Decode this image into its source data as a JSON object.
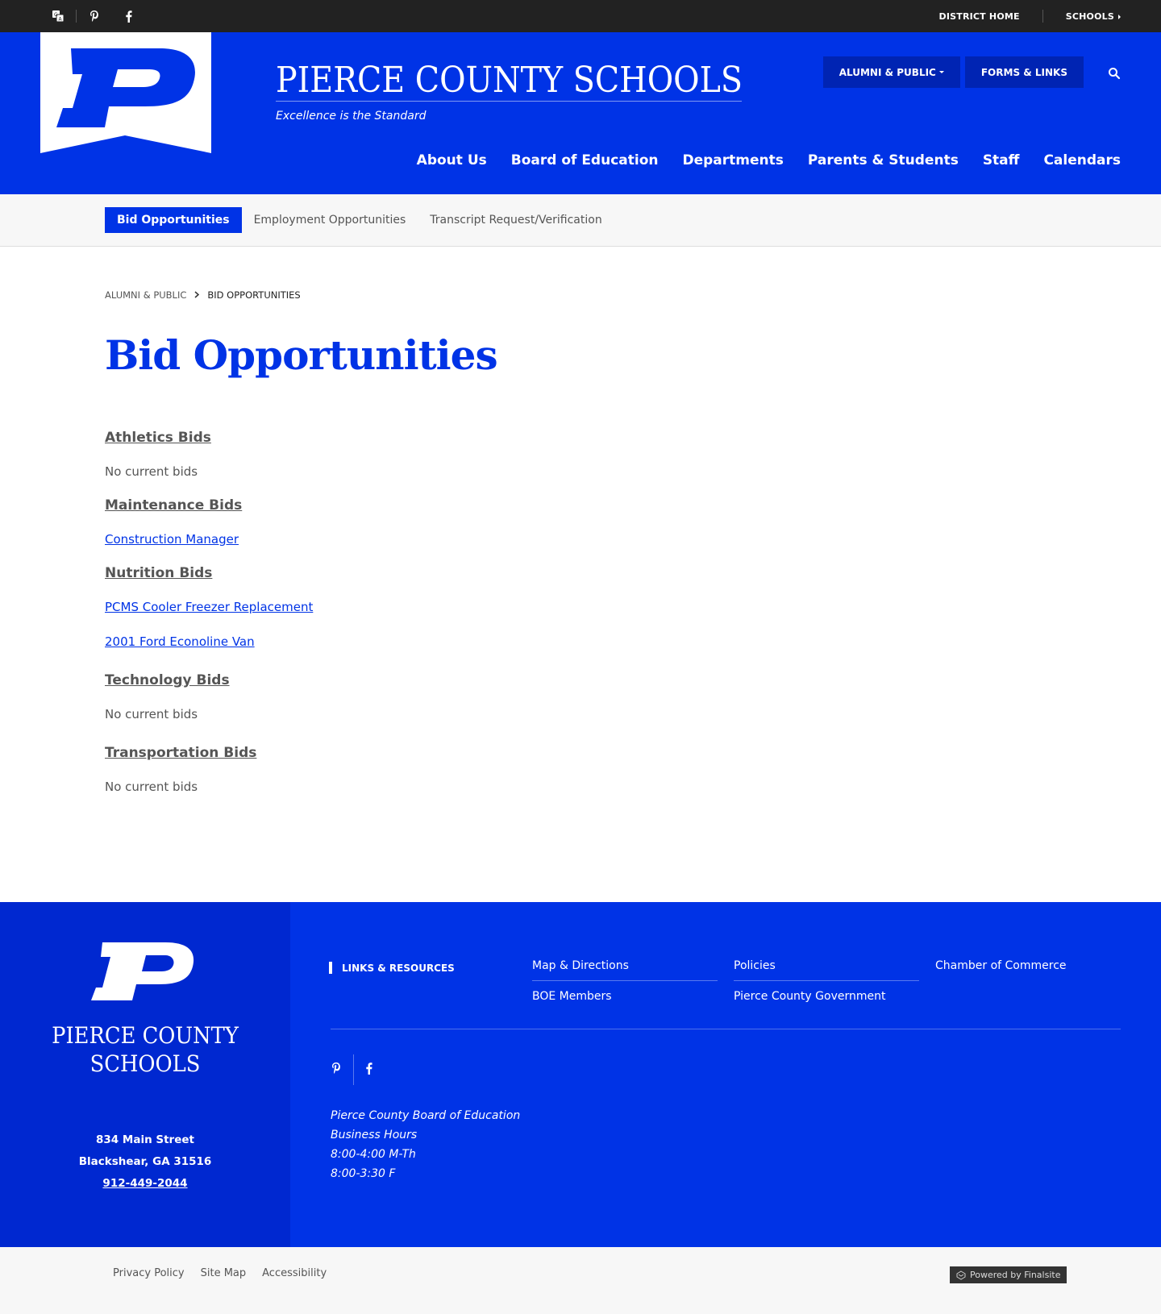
{
  "utility": {
    "icons": [
      "translate-icon",
      "pinterest-icon",
      "facebook-icon"
    ],
    "district_home": "DISTRICT HOME",
    "schools": "SCHOOLS"
  },
  "header": {
    "site_name": "PIERCE COUNTY SCHOOLS",
    "tagline": "Excellence is the Standard",
    "buttons": [
      "ALUMNI & PUBLIC",
      "FORMS & LINKS"
    ],
    "nav": [
      "About Us",
      "Board of Education",
      "Departments",
      "Parents & Students",
      "Staff",
      "Calendars"
    ]
  },
  "subnav": [
    "Bid Opportunities",
    "Employment Opportunities",
    "Transcript Request/Verification"
  ],
  "breadcrumb": {
    "parent": "ALUMNI & PUBLIC",
    "current": "BID OPPORTUNITIES"
  },
  "page_title": "Bid Opportunities",
  "sections": [
    {
      "heading": "Athletics Bids",
      "items": [
        {
          "text": "No current bids",
          "link": false
        }
      ]
    },
    {
      "heading": "Maintenance Bids",
      "items": [
        {
          "text": "Construction Manager",
          "link": true
        }
      ]
    },
    {
      "heading": "Nutrition Bids",
      "items": [
        {
          "text": "PCMS Cooler Freezer Replacement",
          "link": true
        },
        {
          "text": "2001 Ford Econoline Van",
          "link": true
        }
      ]
    },
    {
      "heading": "Technology Bids",
      "items": [
        {
          "text": "No current bids",
          "link": false
        }
      ]
    },
    {
      "heading": "Transportation Bids",
      "items": [
        {
          "text": "No current bids",
          "link": false
        }
      ]
    }
  ],
  "footer": {
    "name_line1": "PIERCE COUNTY",
    "name_line2": "SCHOOLS",
    "address1": "834 Main Street",
    "address2": "Blackshear, GA  31516",
    "phone": "912-449-2044",
    "links_heading": "LINKS & RESOURCES",
    "links": [
      "Map & Directions",
      "Policies",
      "Chamber of Commerce",
      "BOE Members",
      "Pierce County Government"
    ],
    "hours": [
      "Pierce County Board of Education",
      "Business Hours",
      "8:00-4:00 M-Th",
      "8:00-3:30 F"
    ]
  },
  "bottom": {
    "links": [
      "Privacy Policy",
      "Site Map",
      "Accessibility"
    ],
    "powered": "Powered by Finalsite"
  },
  "colors": {
    "brand_blue": "#0033e6",
    "dark_blue": "#0024b3",
    "utility_bg": "#222222"
  }
}
